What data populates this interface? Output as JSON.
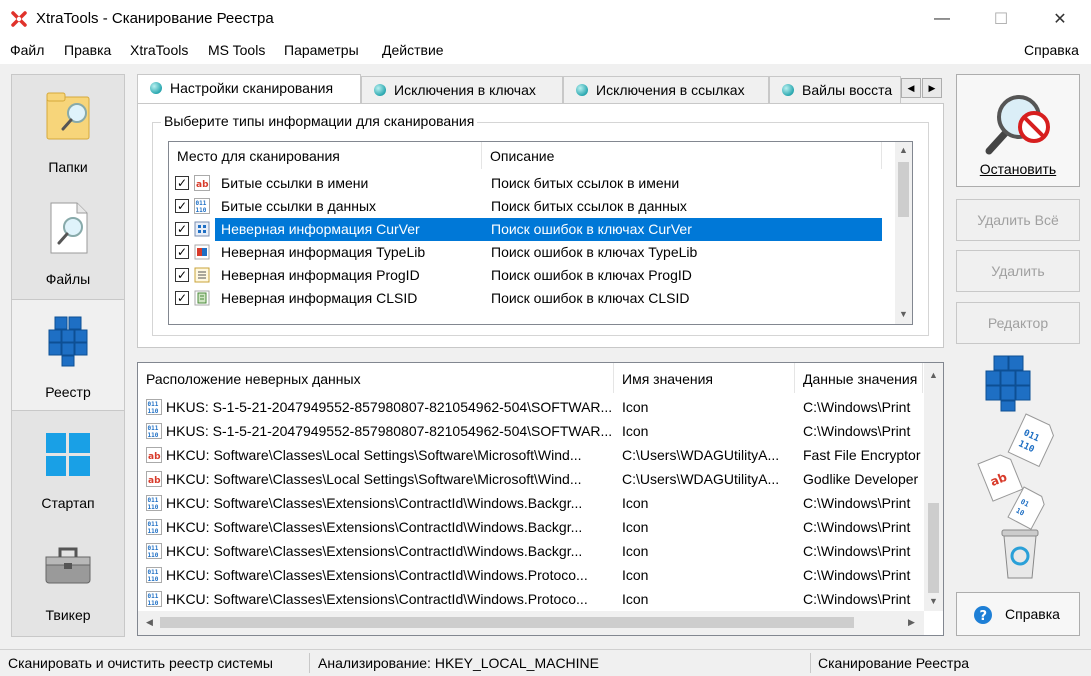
{
  "window": {
    "title": "XtraTools - Сканирование Реестра",
    "minimize": "—",
    "maximize": "☐",
    "close": "✕"
  },
  "menu": {
    "items": [
      "Файл",
      "Правка",
      "XtraTools",
      "MS Tools",
      "Параметры",
      "Действие"
    ],
    "help": "Справка"
  },
  "sidebar": {
    "items": [
      {
        "label": "Папки",
        "icon": "folder-search-icon"
      },
      {
        "label": "Файлы",
        "icon": "file-search-icon"
      },
      {
        "label": "Реестр",
        "icon": "registry-cubes-icon"
      },
      {
        "label": "Стартап",
        "icon": "windows-logo-icon"
      },
      {
        "label": "Твикер",
        "icon": "toolbox-icon"
      }
    ],
    "active": 2
  },
  "tabs": [
    "Настройки сканирования",
    "Исключения в ключах",
    "Исключения в ссылках",
    "Вайлы восста"
  ],
  "scan_group": {
    "title": "Выберите типы информации для сканирования",
    "headers": [
      "Место для сканирования",
      "Описание"
    ],
    "rows": [
      {
        "name": "Битые ссылки в имени",
        "desc": "Поиск битых ссылок в имени",
        "checked": true
      },
      {
        "name": "Битые ссылки в данных",
        "desc": "Поиск битых ссылок в данных",
        "checked": true
      },
      {
        "name": "Неверная информация CurVer",
        "desc": "Поиск ошибок в ключах CurVer",
        "checked": true
      },
      {
        "name": "Неверная информация TypeLib",
        "desc": "Поиск ошибок в ключах TypeLib",
        "checked": true
      },
      {
        "name": "Неверная информация ProgID",
        "desc": "Поиск ошибок в ключах ProgID",
        "checked": true
      },
      {
        "name": "Неверная информация CLSID",
        "desc": "Поиск ошибок в ключах CLSID",
        "checked": true
      }
    ]
  },
  "results": {
    "headers": [
      "Расположение неверных данных",
      "Имя значения",
      "Данные значения"
    ],
    "rows": [
      {
        "icon": "binary",
        "path": "HKUS: S-1-5-21-2047949552-857980807-821054962-504\\SOFTWAR...",
        "name": "Icon",
        "data": "C:\\Windows\\Print"
      },
      {
        "icon": "binary",
        "path": "HKUS: S-1-5-21-2047949552-857980807-821054962-504\\SOFTWAR...",
        "name": "Icon",
        "data": "C:\\Windows\\Print"
      },
      {
        "icon": "ab",
        "path": "HKCU: Software\\Classes\\Local Settings\\Software\\Microsoft\\Wind...",
        "name": "C:\\Users\\WDAGUtilityA...",
        "data": "Fast File Encryptor"
      },
      {
        "icon": "ab",
        "path": "HKCU: Software\\Classes\\Local Settings\\Software\\Microsoft\\Wind...",
        "name": "C:\\Users\\WDAGUtilityA...",
        "data": "Godlike Developer"
      },
      {
        "icon": "binary",
        "path": "HKCU: Software\\Classes\\Extensions\\ContractId\\Windows.Backgr...",
        "name": "Icon",
        "data": "C:\\Windows\\Print"
      },
      {
        "icon": "binary",
        "path": "HKCU: Software\\Classes\\Extensions\\ContractId\\Windows.Backgr...",
        "name": "Icon",
        "data": "C:\\Windows\\Print"
      },
      {
        "icon": "binary",
        "path": "HKCU: Software\\Classes\\Extensions\\ContractId\\Windows.Backgr...",
        "name": "Icon",
        "data": "C:\\Windows\\Print"
      },
      {
        "icon": "binary",
        "path": "HKCU: Software\\Classes\\Extensions\\ContractId\\Windows.Protoco...",
        "name": "Icon",
        "data": "C:\\Windows\\Print"
      },
      {
        "icon": "binary",
        "path": "HKCU: Software\\Classes\\Extensions\\ContractId\\Windows.Protoco...",
        "name": "Icon",
        "data": "C:\\Windows\\Print"
      }
    ]
  },
  "actions": {
    "stop": "Остановить",
    "delete_all": "Удалить Всё",
    "delete": "Удалить",
    "editor": "Редактор",
    "help": "Справка"
  },
  "status": {
    "left": "Сканировать и очистить реестр системы",
    "middle": "Анализирование:  HKEY_LOCAL_MACHINE",
    "right": "Сканирование Реестра"
  },
  "colors": {
    "selection": "#0078d7",
    "accent_blue": "#1e7fd6",
    "red_ab": "#d83b2b"
  }
}
